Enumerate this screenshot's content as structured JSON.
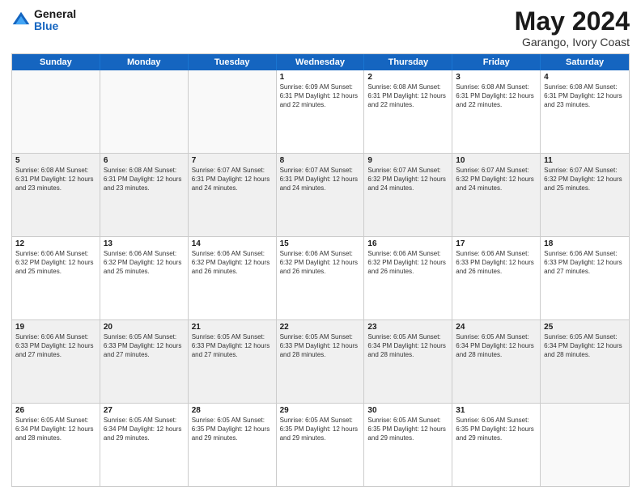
{
  "header": {
    "logo": {
      "general": "General",
      "blue": "Blue"
    },
    "month_year": "May 2024",
    "location": "Garango, Ivory Coast"
  },
  "day_headers": [
    "Sunday",
    "Monday",
    "Tuesday",
    "Wednesday",
    "Thursday",
    "Friday",
    "Saturday"
  ],
  "weeks": [
    {
      "alt": false,
      "days": [
        {
          "num": "",
          "info": "",
          "empty": true
        },
        {
          "num": "",
          "info": "",
          "empty": true
        },
        {
          "num": "",
          "info": "",
          "empty": true
        },
        {
          "num": "1",
          "info": "Sunrise: 6:09 AM\nSunset: 6:31 PM\nDaylight: 12 hours\nand 22 minutes.",
          "empty": false
        },
        {
          "num": "2",
          "info": "Sunrise: 6:08 AM\nSunset: 6:31 PM\nDaylight: 12 hours\nand 22 minutes.",
          "empty": false
        },
        {
          "num": "3",
          "info": "Sunrise: 6:08 AM\nSunset: 6:31 PM\nDaylight: 12 hours\nand 22 minutes.",
          "empty": false
        },
        {
          "num": "4",
          "info": "Sunrise: 6:08 AM\nSunset: 6:31 PM\nDaylight: 12 hours\nand 23 minutes.",
          "empty": false
        }
      ]
    },
    {
      "alt": true,
      "days": [
        {
          "num": "5",
          "info": "Sunrise: 6:08 AM\nSunset: 6:31 PM\nDaylight: 12 hours\nand 23 minutes.",
          "empty": false
        },
        {
          "num": "6",
          "info": "Sunrise: 6:08 AM\nSunset: 6:31 PM\nDaylight: 12 hours\nand 23 minutes.",
          "empty": false
        },
        {
          "num": "7",
          "info": "Sunrise: 6:07 AM\nSunset: 6:31 PM\nDaylight: 12 hours\nand 24 minutes.",
          "empty": false
        },
        {
          "num": "8",
          "info": "Sunrise: 6:07 AM\nSunset: 6:31 PM\nDaylight: 12 hours\nand 24 minutes.",
          "empty": false
        },
        {
          "num": "9",
          "info": "Sunrise: 6:07 AM\nSunset: 6:32 PM\nDaylight: 12 hours\nand 24 minutes.",
          "empty": false
        },
        {
          "num": "10",
          "info": "Sunrise: 6:07 AM\nSunset: 6:32 PM\nDaylight: 12 hours\nand 24 minutes.",
          "empty": false
        },
        {
          "num": "11",
          "info": "Sunrise: 6:07 AM\nSunset: 6:32 PM\nDaylight: 12 hours\nand 25 minutes.",
          "empty": false
        }
      ]
    },
    {
      "alt": false,
      "days": [
        {
          "num": "12",
          "info": "Sunrise: 6:06 AM\nSunset: 6:32 PM\nDaylight: 12 hours\nand 25 minutes.",
          "empty": false
        },
        {
          "num": "13",
          "info": "Sunrise: 6:06 AM\nSunset: 6:32 PM\nDaylight: 12 hours\nand 25 minutes.",
          "empty": false
        },
        {
          "num": "14",
          "info": "Sunrise: 6:06 AM\nSunset: 6:32 PM\nDaylight: 12 hours\nand 26 minutes.",
          "empty": false
        },
        {
          "num": "15",
          "info": "Sunrise: 6:06 AM\nSunset: 6:32 PM\nDaylight: 12 hours\nand 26 minutes.",
          "empty": false
        },
        {
          "num": "16",
          "info": "Sunrise: 6:06 AM\nSunset: 6:32 PM\nDaylight: 12 hours\nand 26 minutes.",
          "empty": false
        },
        {
          "num": "17",
          "info": "Sunrise: 6:06 AM\nSunset: 6:33 PM\nDaylight: 12 hours\nand 26 minutes.",
          "empty": false
        },
        {
          "num": "18",
          "info": "Sunrise: 6:06 AM\nSunset: 6:33 PM\nDaylight: 12 hours\nand 27 minutes.",
          "empty": false
        }
      ]
    },
    {
      "alt": true,
      "days": [
        {
          "num": "19",
          "info": "Sunrise: 6:06 AM\nSunset: 6:33 PM\nDaylight: 12 hours\nand 27 minutes.",
          "empty": false
        },
        {
          "num": "20",
          "info": "Sunrise: 6:05 AM\nSunset: 6:33 PM\nDaylight: 12 hours\nand 27 minutes.",
          "empty": false
        },
        {
          "num": "21",
          "info": "Sunrise: 6:05 AM\nSunset: 6:33 PM\nDaylight: 12 hours\nand 27 minutes.",
          "empty": false
        },
        {
          "num": "22",
          "info": "Sunrise: 6:05 AM\nSunset: 6:33 PM\nDaylight: 12 hours\nand 28 minutes.",
          "empty": false
        },
        {
          "num": "23",
          "info": "Sunrise: 6:05 AM\nSunset: 6:34 PM\nDaylight: 12 hours\nand 28 minutes.",
          "empty": false
        },
        {
          "num": "24",
          "info": "Sunrise: 6:05 AM\nSunset: 6:34 PM\nDaylight: 12 hours\nand 28 minutes.",
          "empty": false
        },
        {
          "num": "25",
          "info": "Sunrise: 6:05 AM\nSunset: 6:34 PM\nDaylight: 12 hours\nand 28 minutes.",
          "empty": false
        }
      ]
    },
    {
      "alt": false,
      "days": [
        {
          "num": "26",
          "info": "Sunrise: 6:05 AM\nSunset: 6:34 PM\nDaylight: 12 hours\nand 28 minutes.",
          "empty": false
        },
        {
          "num": "27",
          "info": "Sunrise: 6:05 AM\nSunset: 6:34 PM\nDaylight: 12 hours\nand 29 minutes.",
          "empty": false
        },
        {
          "num": "28",
          "info": "Sunrise: 6:05 AM\nSunset: 6:35 PM\nDaylight: 12 hours\nand 29 minutes.",
          "empty": false
        },
        {
          "num": "29",
          "info": "Sunrise: 6:05 AM\nSunset: 6:35 PM\nDaylight: 12 hours\nand 29 minutes.",
          "empty": false
        },
        {
          "num": "30",
          "info": "Sunrise: 6:05 AM\nSunset: 6:35 PM\nDaylight: 12 hours\nand 29 minutes.",
          "empty": false
        },
        {
          "num": "31",
          "info": "Sunrise: 6:06 AM\nSunset: 6:35 PM\nDaylight: 12 hours\nand 29 minutes.",
          "empty": false
        },
        {
          "num": "",
          "info": "",
          "empty": true
        }
      ]
    }
  ]
}
